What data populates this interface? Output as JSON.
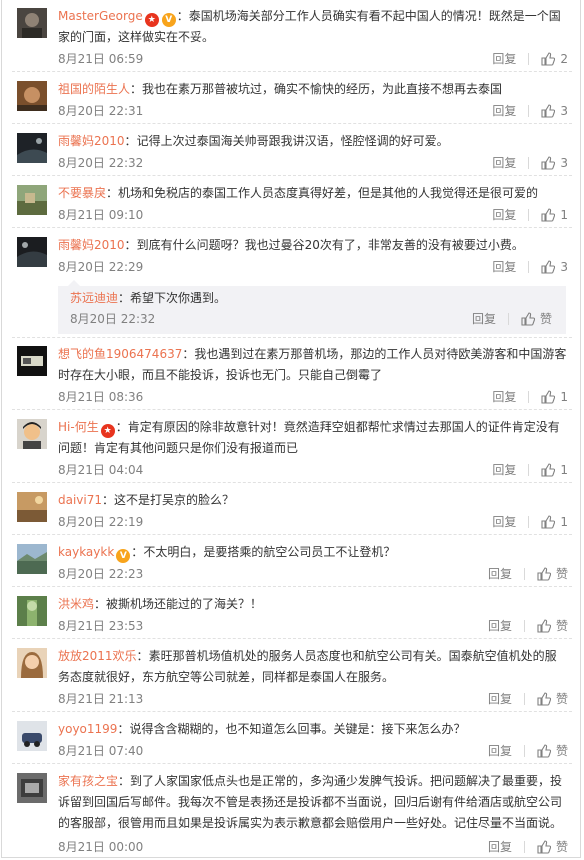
{
  "ui": {
    "reply_label": "回复",
    "praise_label": "赞"
  },
  "comments": [
    {
      "user": "MasterGeorge",
      "badges": [
        "star",
        "vip"
      ],
      "sep": "：",
      "text": "泰国机场海关部分工作人员确实有看不起中国人的情况！既然是一个国家的门面，这样做实在不妥。",
      "time": "8月21日 06:59",
      "likes": "2"
    },
    {
      "user": "祖国的陌生人",
      "badges": [],
      "sep": "：",
      "text": "我也在素万那普被坑过，确实不愉快的经历，为此直接不想再去泰国",
      "time": "8月20日 22:31",
      "likes": "3"
    },
    {
      "user": "雨馨妈2010",
      "badges": [],
      "sep": "：",
      "text": "记得上次过泰国海关帅哥跟我讲汉语，怪腔怪调的好可爱。",
      "time": "8月20日 22:32",
      "likes": "3"
    },
    {
      "user": "不要暴戾",
      "badges": [],
      "sep": "：",
      "text": "机场和免税店的泰国工作人员态度真得好差，但是其他的人我觉得还是很可爱的",
      "time": "8月21日 09:10",
      "likes": "1"
    },
    {
      "user": "雨馨妈2010",
      "badges": [],
      "sep": "：",
      "text": "到底有什么问题呀？我也过曼谷20次有了，非常友善的没有被要过小费。",
      "time": "8月20日 22:29",
      "likes": "3"
    },
    {
      "user": "想飞的鱼1906474637",
      "badges": [],
      "sep": "：",
      "text": "我也遇到过在素万那普机场，那边的工作人员对待欧美游客和中国游客时存在大小眼，而且不能投诉，投诉也无门。只能自己倒霉了",
      "time": "8月21日 08:36",
      "likes": "1"
    },
    {
      "user": "Hi-何生",
      "badges": [
        "star"
      ],
      "sep": "：",
      "text": "肯定有原因的除非故意针对！竟然造拜空姐都帮忙求情过去那国人的证件肯定没有问题！肯定有其他问题只是你们没有报道而已",
      "time": "8月21日 04:04",
      "likes": "1"
    },
    {
      "user": "daivi71",
      "badges": [],
      "sep": "：",
      "text": "这不是打吴京的脸么？",
      "time": "8月20日 22:19",
      "likes": "1"
    },
    {
      "user": "kaykaykk",
      "badges": [
        "vip"
      ],
      "sep": "：",
      "text": "不太明白，是要搭乘的航空公司员工不让登机？",
      "time": "8月20日 22:23",
      "likes": "赞"
    },
    {
      "user": "洪米鸡",
      "badges": [],
      "sep": "：",
      "text": "被撕机场还能过的了海关？！",
      "time": "8月21日 23:53",
      "likes": "赞"
    },
    {
      "user": "放放2011欢乐",
      "badges": [],
      "sep": "：",
      "text": "素旺那普机场值机处的服务人员态度也和航空公司有关。国泰航空值机处的服务态度就很好，东方航空等公司就差，同样都是泰国人在服务。",
      "time": "8月21日 21:13",
      "likes": "赞"
    },
    {
      "user": "yoyo1199",
      "badges": [],
      "sep": "：",
      "text": "说得含含糊糊的，也不知道怎么回事。关键是：接下来怎么办？",
      "time": "8月21日 07:40",
      "likes": "赞"
    },
    {
      "user": "家有孩之宝",
      "badges": [],
      "sep": "：",
      "text": "到了人家国家低点头也是正常的，多沟通少发脾气投诉。把问题解决了最重要，投诉留到回国后写邮件。我每次不管是表扬还是投诉都不当面说，回归后谢有件给酒店或航空公司的客服部，很管用而且如果是投诉属实为表示歉意都会赔偿用户一些好处。记住尽量不当面说。",
      "time": "8月21日 00:00",
      "likes": "赞"
    }
  ],
  "subreply": {
    "user": "苏远迪迪",
    "sep": "：",
    "text": "希望下次你遇到。",
    "time": "8月20日 22:32",
    "likes": "赞"
  }
}
